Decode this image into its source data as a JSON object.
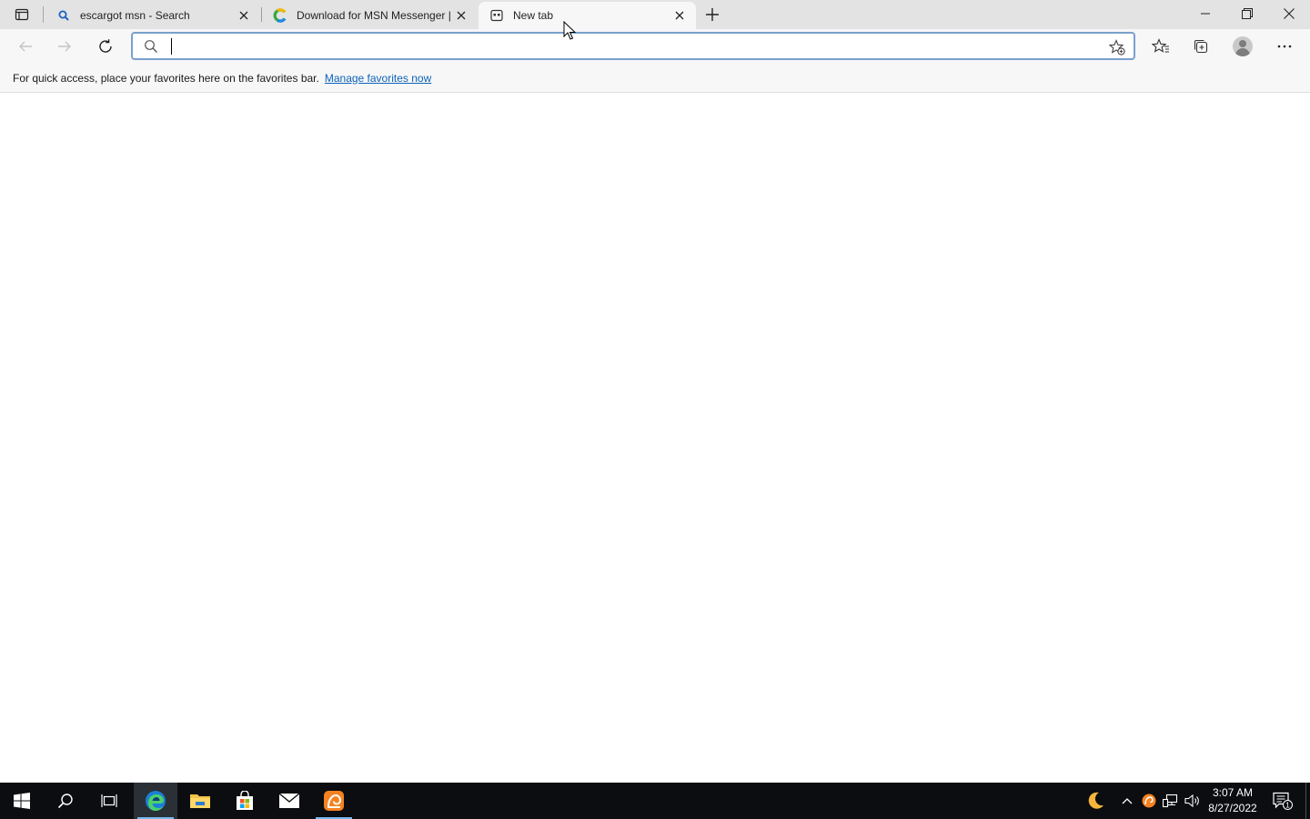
{
  "browser": {
    "tabs": [
      {
        "title": "escargot msn - Search",
        "favicon": "search-icon",
        "active": false
      },
      {
        "title": "Download for MSN Messenger |",
        "favicon": "colorful-c-icon",
        "active": false
      },
      {
        "title": "New tab",
        "favicon": "new-tab-page-icon",
        "active": true
      }
    ],
    "address_bar": {
      "value": "",
      "placeholder": ""
    },
    "favorites_bar": {
      "message": "For quick access, place your favorites here on the favorites bar.",
      "link": "Manage favorites now"
    }
  },
  "taskbar": {
    "apps": [
      "start-icon",
      "search-icon",
      "task-view-icon",
      "edge-icon",
      "file-explorer-icon",
      "store-icon",
      "mail-icon",
      "escargot-icon"
    ],
    "clock": {
      "time": "3:07 AM",
      "date": "8/27/2022"
    },
    "notification_count": "1"
  },
  "colors": {
    "accent": "#0e63b8",
    "taskbar": "#0b0d10",
    "tabstrip": "#e3e3e3",
    "toolbar": "#f7f7f7"
  }
}
